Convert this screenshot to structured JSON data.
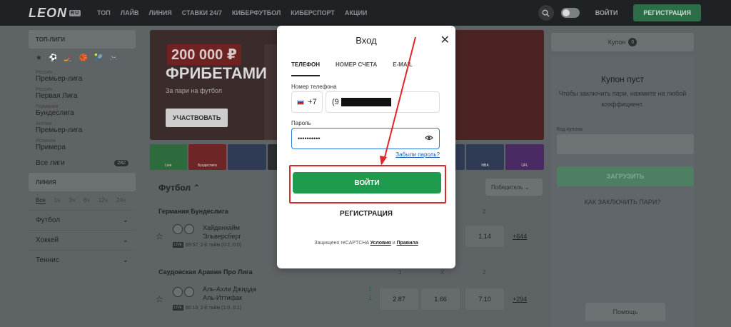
{
  "header": {
    "logo": "LEON",
    "logo_badge": "RU",
    "nav": [
      "ТОП",
      "ЛАЙВ",
      "ЛИНИЯ",
      "СТАВКИ 24/7",
      "КИБЕРФУТБОЛ",
      "КИБЕРСПОРТ",
      "АКЦИИ"
    ],
    "search_icon": "search-icon",
    "login": "ВОЙТИ",
    "register": "РЕГИСТРАЦИЯ"
  },
  "sidebar": {
    "top_leagues": "ТОП-ЛИГИ",
    "sport_icons": [
      "★",
      "⚽",
      "🏒",
      "🏀",
      "🎾",
      "🎮"
    ],
    "leagues": [
      {
        "country": "Россия",
        "name": "Премьер-лига"
      },
      {
        "country": "Россия",
        "name": "Первая Лига"
      },
      {
        "country": "Германия",
        "name": "Бундеслига"
      },
      {
        "country": "Англия",
        "name": "Премьер-лига"
      },
      {
        "country": "Испания",
        "name": "Примера"
      }
    ],
    "all_leagues": "Все лиги",
    "all_count": "282",
    "live_title": "ЛИНИЯ",
    "time_filters": [
      "Все",
      "1ч",
      "3ч",
      "6ч",
      "12ч",
      "24ч"
    ],
    "sports": [
      "Футбол",
      "Хоккей",
      "Теннис"
    ]
  },
  "banner": {
    "amount": "200 000 ₽",
    "title": "ФРИБЕТАМИ",
    "subtitle": "За пари на футбол",
    "cta": "УЧАСТВОВАТЬ"
  },
  "tiles": [
    "Live",
    "Бундеслига",
    "",
    "",
    "",
    "",
    "",
    "",
    "",
    "NBA",
    "UFL"
  ],
  "events": {
    "section": "Футбол",
    "market": "Победитель",
    "groups": [
      {
        "league": "Германия Бундеслига",
        "cols": [
          "1",
          "X",
          "2"
        ],
        "team1": "Хайденхайм",
        "team2": "Эльверсберг",
        "time": "89:57",
        "period": "2-й тайм (0:2, 0:0)",
        "score1": "",
        "score2": "",
        "odds": [
          "",
          "",
          "1.14"
        ],
        "more": "+644"
      },
      {
        "league": "Саудовская Аравия Про Лига",
        "cols": [
          "1",
          "X",
          "2"
        ],
        "team1": "Аль-Ахли Джидда",
        "team2": "Аль-Иттифак",
        "time": "80:10",
        "period": "2-й тайм (1:0, 0:1)",
        "score1": "1",
        "score2": "1",
        "odds": [
          "2.87",
          "1.66",
          "7.10"
        ],
        "more": "+294"
      }
    ]
  },
  "coupon": {
    "tab": "Купон",
    "tab_count": "0",
    "empty_title": "Купон пуст",
    "empty_hint": "Чтобы заключить пари, нажмите на любой коэффициент.",
    "code_label": "Код купона",
    "load": "ЗАГРУЗИТЬ",
    "how_to": "КАК ЗАКЛЮЧИТЬ ПАРИ?",
    "help": "Помощь"
  },
  "modal": {
    "title": "Вход",
    "tabs": [
      "ТЕЛЕФОН",
      "НОМЕР СЧЕТА",
      "E-MAIL"
    ],
    "phone_label": "Номер телефона",
    "country_code": "+7",
    "phone_value": "(9",
    "password_label": "Пароль",
    "password_value": "••••••••••",
    "forgot": "Забыли пароль?",
    "login_button": "ВОЙТИ",
    "register_link": "РЕГИСТРАЦИЯ",
    "recaptcha": "Защищено reCAPTCHA",
    "terms": "Условия",
    "and": "и",
    "privacy": "Правила"
  },
  "colors": {
    "accent_green": "#1f9b4e",
    "highlight_red": "#e0262a",
    "input_focus": "#2e7bd6"
  }
}
